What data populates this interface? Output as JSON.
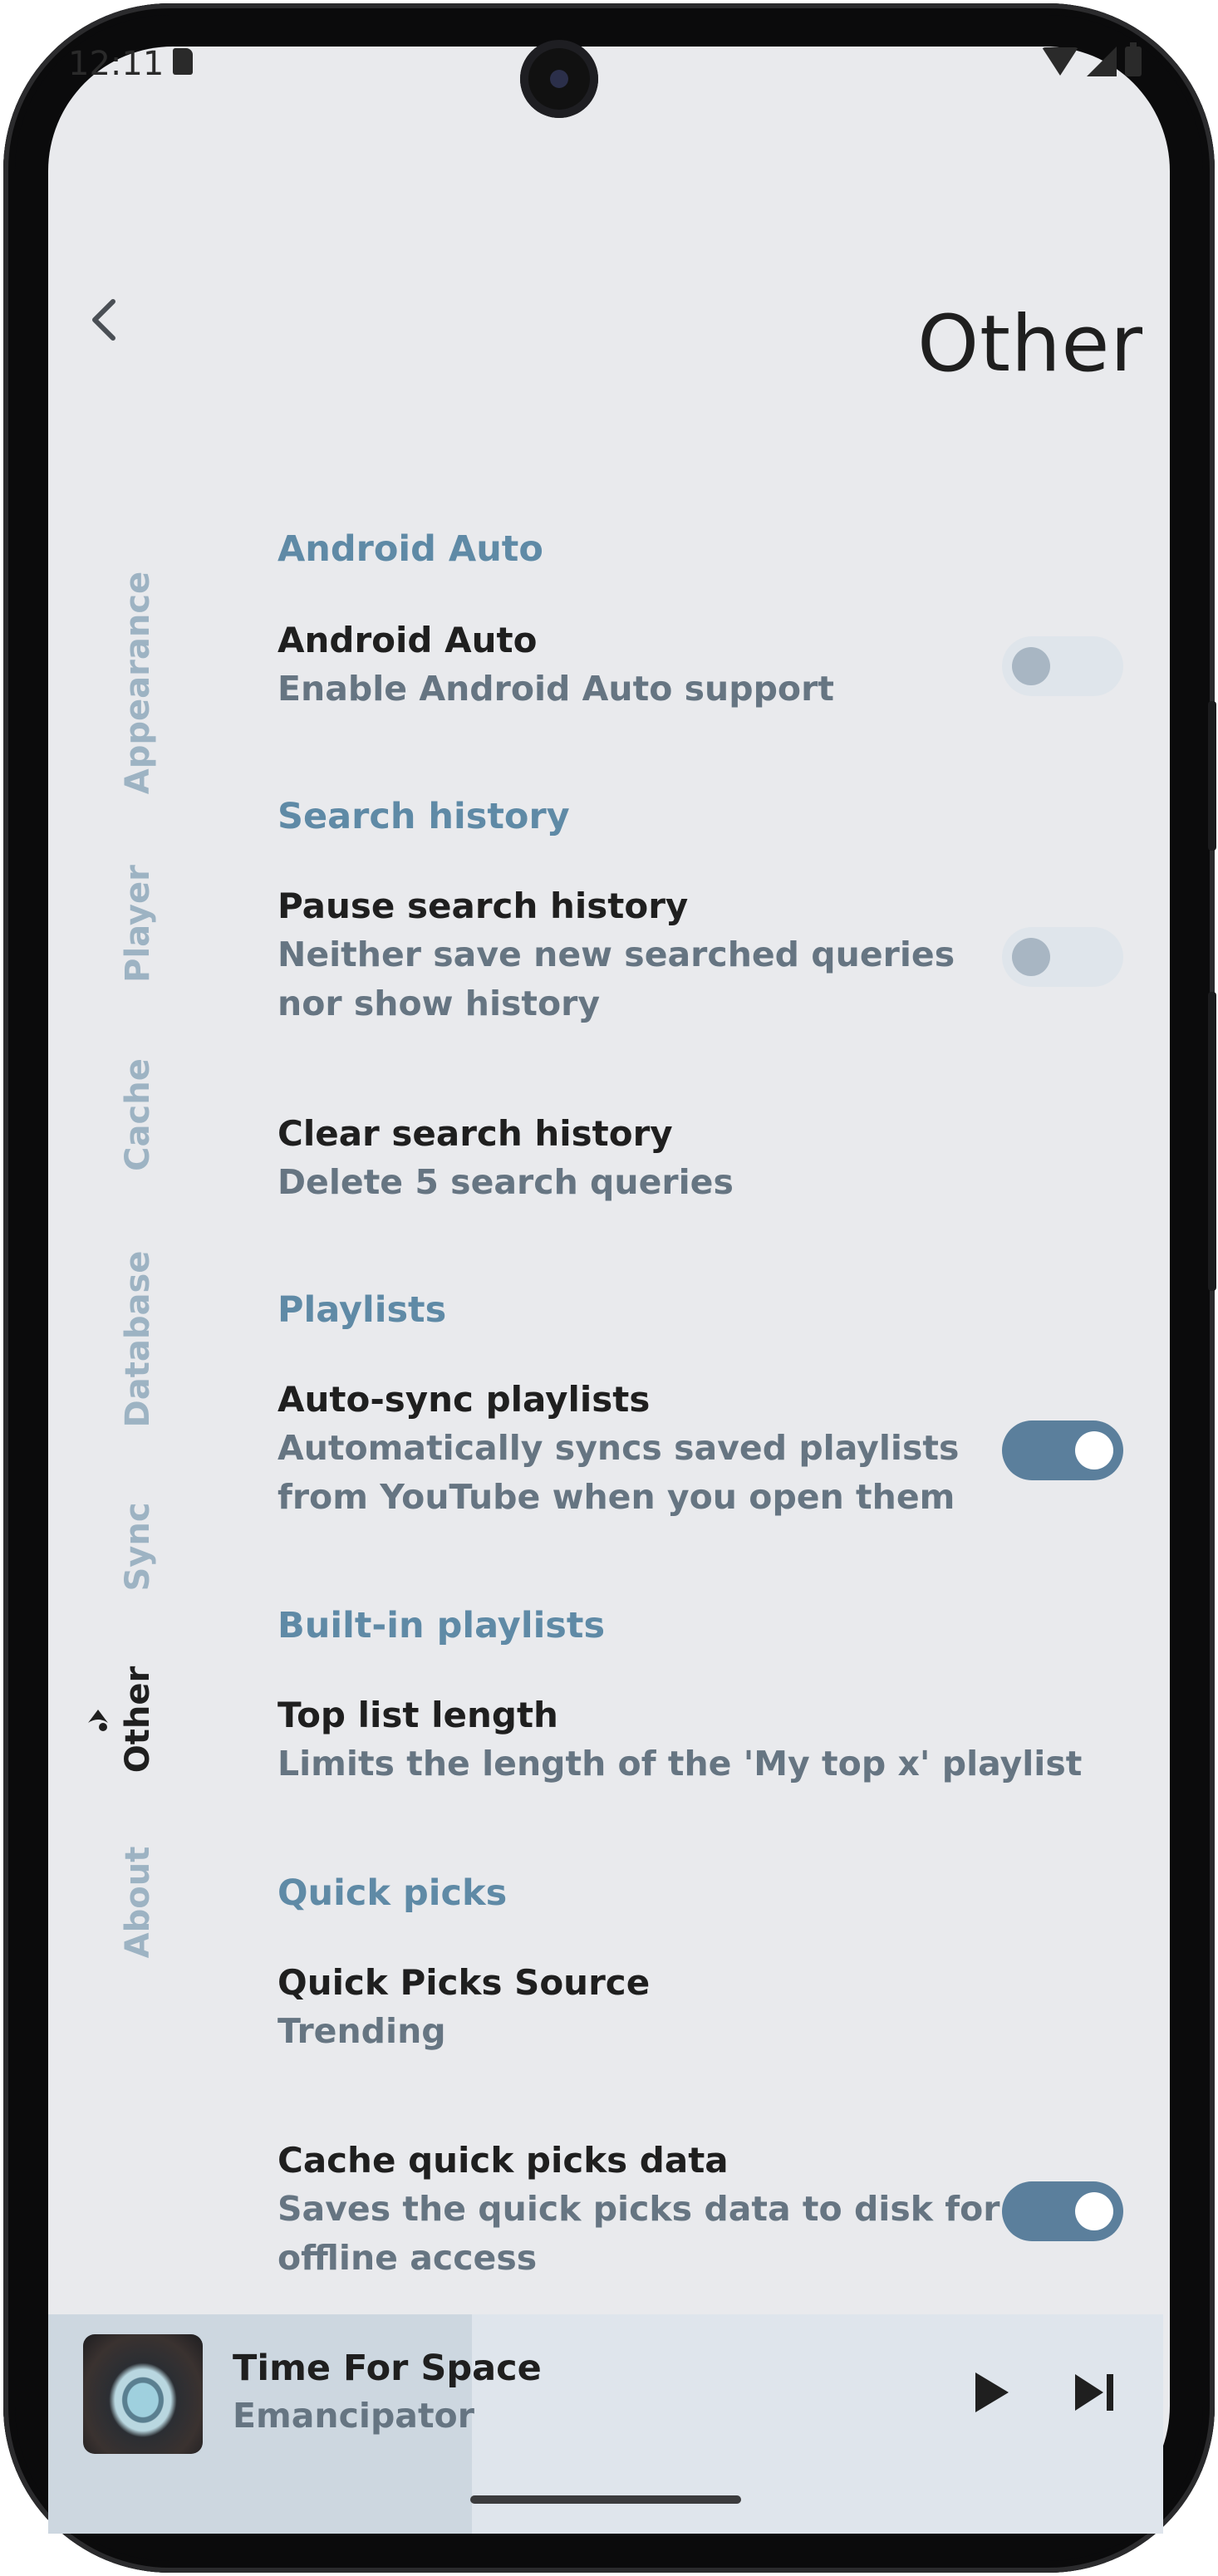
{
  "status_bar": {
    "time": "12:11"
  },
  "header": {
    "title": "Other"
  },
  "vertical_nav": {
    "items": [
      {
        "label": "Appearance"
      },
      {
        "label": "Player"
      },
      {
        "label": "Cache"
      },
      {
        "label": "Database"
      },
      {
        "label": "Sync"
      },
      {
        "label": "Other",
        "active": true
      },
      {
        "label": "About"
      }
    ]
  },
  "sections": {
    "android_auto": {
      "title": "Android Auto",
      "items": [
        {
          "title": "Android Auto",
          "description": "Enable Android Auto support",
          "toggle": false
        }
      ]
    },
    "search_history": {
      "title": "Search history",
      "items": [
        {
          "title": "Pause search history",
          "description_line1": "Neither save new searched queries",
          "description_line2": "nor show history",
          "toggle": false
        },
        {
          "title": "Clear search history",
          "description": "Delete 5 search queries"
        }
      ]
    },
    "playlists": {
      "title": "Playlists",
      "items": [
        {
          "title": "Auto-sync playlists",
          "description_line1": "Automatically syncs saved playlists",
          "description_line2": "from YouTube when you open them",
          "toggle": true
        }
      ]
    },
    "builtin_playlists": {
      "title": "Built-in playlists",
      "items": [
        {
          "title": "Top list length",
          "description": "Limits the length of the 'My top x' playlist"
        }
      ]
    },
    "quick_picks": {
      "title": "Quick picks",
      "items": [
        {
          "title": "Quick Picks Source",
          "description": "Trending"
        },
        {
          "title": "Cache quick picks data",
          "description_line1": "Saves the quick picks data to disk for",
          "description_line2": "offline access",
          "toggle": true
        }
      ]
    }
  },
  "mini_player": {
    "title": "Time For Space",
    "artist": "Emancipator",
    "progress": 0.38
  },
  "colors": {
    "background": "#e9eaed",
    "accent": "#5b7f9c",
    "section_title": "#5f8aa6",
    "nav_inactive": "#9db3c3"
  }
}
